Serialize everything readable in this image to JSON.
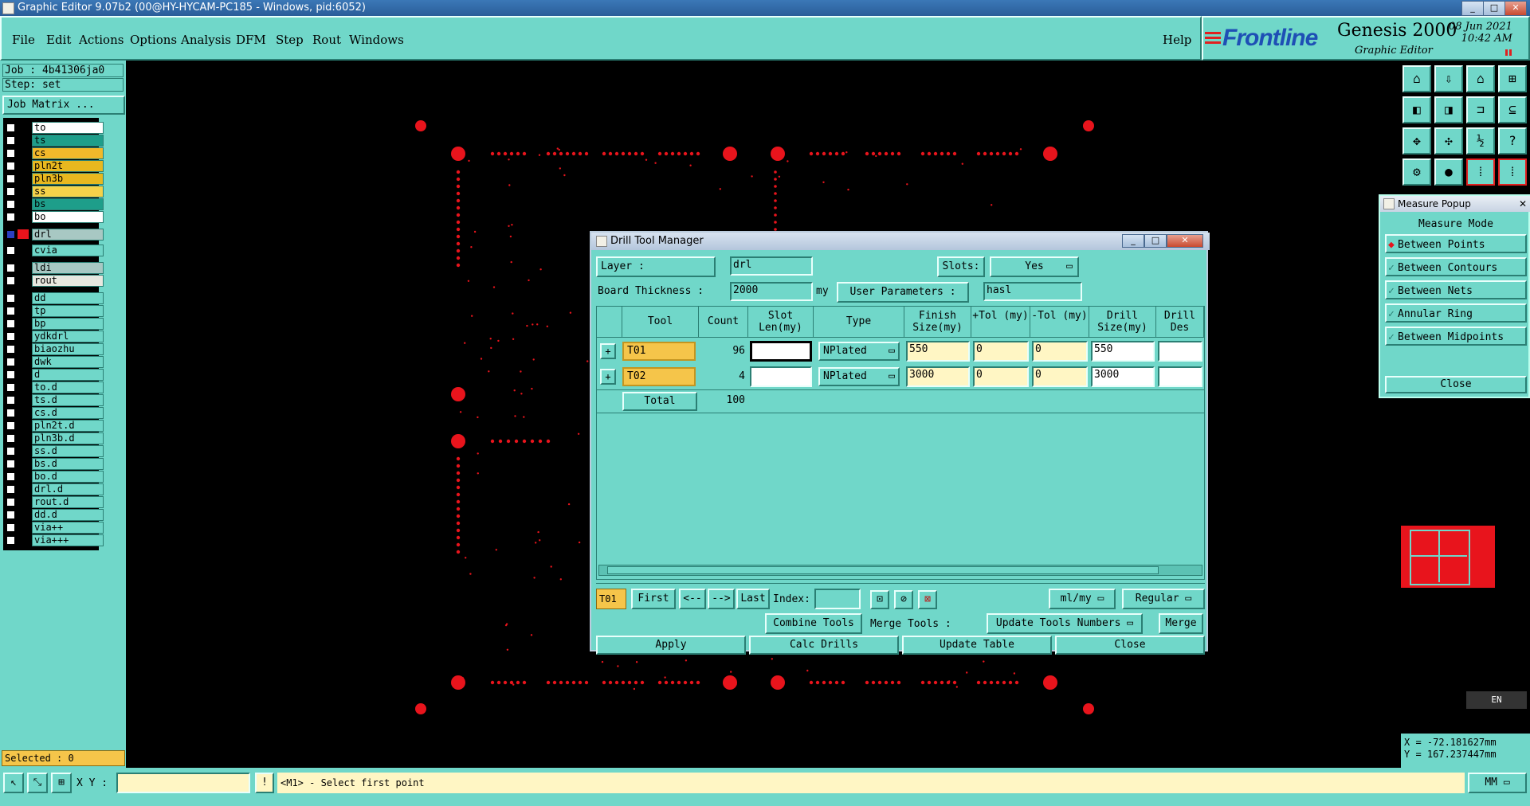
{
  "window": {
    "title": "Graphic Editor 9.07b2 (00@HY-HYCAM-PC185 - Windows, pid:6052)",
    "controls": [
      "_",
      "□",
      "✕"
    ]
  },
  "menu": {
    "items": [
      "File",
      "Edit",
      "Actions",
      "Options",
      "Analysis",
      "DFM",
      "Step",
      "Rout",
      "Windows"
    ],
    "help": "Help"
  },
  "brand": {
    "logo": "Frontline",
    "product": "Genesis 2000",
    "subtitle": "Graphic Editor",
    "date": "08 Jun 2021",
    "time": "10:42 AM"
  },
  "left_panel": {
    "job": "Job : 4b41306ja0",
    "step": "Step: set",
    "job_matrix": "Job Matrix ...",
    "layers": [
      {
        "name": "to",
        "color": "#ffffff"
      },
      {
        "name": "ts",
        "color": "#1e9e8a"
      },
      {
        "name": "cs",
        "color": "#f2b92b"
      },
      {
        "name": "pln2t",
        "color": "#e8b81f"
      },
      {
        "name": "pln3b",
        "color": "#e8b81f"
      },
      {
        "name": "ss",
        "color": "#f5d24a"
      },
      {
        "name": "bs",
        "color": "#1e9e8a"
      },
      {
        "name": "bo",
        "color": "#ffffff"
      },
      {
        "name": "drl",
        "color": "#a8c8c3",
        "active": true
      },
      {
        "name": "cvia",
        "color": "#70d7c9"
      },
      {
        "name": "ldi",
        "color": "#a8c8c3"
      },
      {
        "name": "rout",
        "color": "#e8e8e0"
      },
      {
        "name": "dd",
        "color": "#70d7c9"
      },
      {
        "name": "tp",
        "color": "#70d7c9"
      },
      {
        "name": "bp",
        "color": "#70d7c9"
      },
      {
        "name": "ydkdrl",
        "color": "#70d7c9"
      },
      {
        "name": "biaozhu",
        "color": "#70d7c9"
      },
      {
        "name": "dwk",
        "color": "#70d7c9"
      },
      {
        "name": "d",
        "color": "#70d7c9"
      },
      {
        "name": "to.d",
        "color": "#70d7c9"
      },
      {
        "name": "ts.d",
        "color": "#70d7c9"
      },
      {
        "name": "cs.d",
        "color": "#70d7c9"
      },
      {
        "name": "pln2t.d",
        "color": "#70d7c9"
      },
      {
        "name": "pln3b.d",
        "color": "#70d7c9"
      },
      {
        "name": "ss.d",
        "color": "#70d7c9"
      },
      {
        "name": "bs.d",
        "color": "#70d7c9"
      },
      {
        "name": "bo.d",
        "color": "#70d7c9"
      },
      {
        "name": "drl.d",
        "color": "#70d7c9"
      },
      {
        "name": "rout.d",
        "color": "#70d7c9"
      },
      {
        "name": "dd.d",
        "color": "#70d7c9"
      },
      {
        "name": "via++",
        "color": "#70d7c9"
      },
      {
        "name": "via+++",
        "color": "#70d7c9"
      }
    ],
    "selected": "Selected : 0"
  },
  "measure_popup": {
    "title": "Measure Popup",
    "heading": "Measure Mode",
    "options": [
      {
        "label": "Between Points",
        "selected": true
      },
      {
        "label": "Between Contours",
        "selected": false
      },
      {
        "label": "Between Nets",
        "selected": false
      },
      {
        "label": "Annular Ring",
        "selected": false
      },
      {
        "label": "Between Midpoints",
        "selected": false
      }
    ],
    "close": "Close"
  },
  "dtm": {
    "title": "Drill Tool Manager",
    "layer_label": "Layer :",
    "layer_value": "drl",
    "slots_label": "Slots:",
    "slots_value": "Yes",
    "thickness_label": "Board Thickness :",
    "thickness_value": "2000",
    "thickness_unit": "my",
    "user_params_label": "User Parameters :",
    "user_params_value": "hasl",
    "columns": [
      "Tool",
      "Count",
      "Slot Len(my)",
      "Type",
      "Finish Size(my)",
      "+Tol (my)",
      "-Tol (my)",
      "Drill Size(my)",
      "Drill Des"
    ],
    "rows": [
      {
        "tool": "T01",
        "count": "96",
        "slot_len": "",
        "type": "NPlated",
        "finish": "550",
        "ptol": "0",
        "mtol": "0",
        "drill": "550",
        "des": ""
      },
      {
        "tool": "T02",
        "count": "4",
        "slot_len": "",
        "type": "NPlated",
        "finish": "3000",
        "ptol": "0",
        "mtol": "0",
        "drill": "3000",
        "des": ""
      }
    ],
    "total_label": "Total",
    "total_value": "100",
    "nav": {
      "current": "T01",
      "first": "First",
      "prev": "<--",
      "next": "-->",
      "last": "Last",
      "index_label": "Index:",
      "units": "ml/my",
      "mode": "Regular"
    },
    "actions": {
      "combine": "Combine Tools",
      "merge_label": "Merge Tools :",
      "merge_option": "Update Tools Numbers",
      "merge": "Merge"
    },
    "bottom": {
      "apply": "Apply",
      "calc": "Calc Drills",
      "update": "Update Table",
      "close": "Close"
    }
  },
  "bottom_bar": {
    "xy_label": "X Y :",
    "prompt": "<M1> - Select first point",
    "units": "MM"
  },
  "coords": {
    "x": "X = -72.181627mm",
    "y": "Y = 167.237447mm"
  },
  "lang": "EN"
}
